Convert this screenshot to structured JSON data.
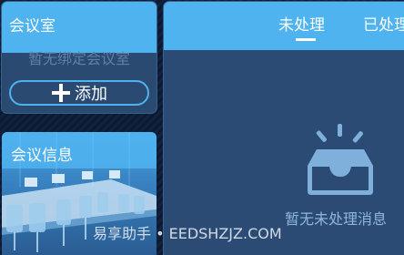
{
  "room_panel": {
    "title": "会议室",
    "empty_text": "暂无绑定会议室",
    "bind_button_label": "添加"
  },
  "info_panel": {
    "title": "会议信息"
  },
  "message_panel": {
    "tabs": [
      {
        "label": "未处理",
        "active": true
      },
      {
        "label": "已处理",
        "active": false
      }
    ],
    "empty_text": "暂无未处理消息"
  },
  "watermark": "易享助手 • EEDSHZJZ.COM",
  "colors": {
    "accent": "#4fb3ef",
    "panel_bg": "#2b4b75",
    "page_bg": "#0e1d35"
  }
}
